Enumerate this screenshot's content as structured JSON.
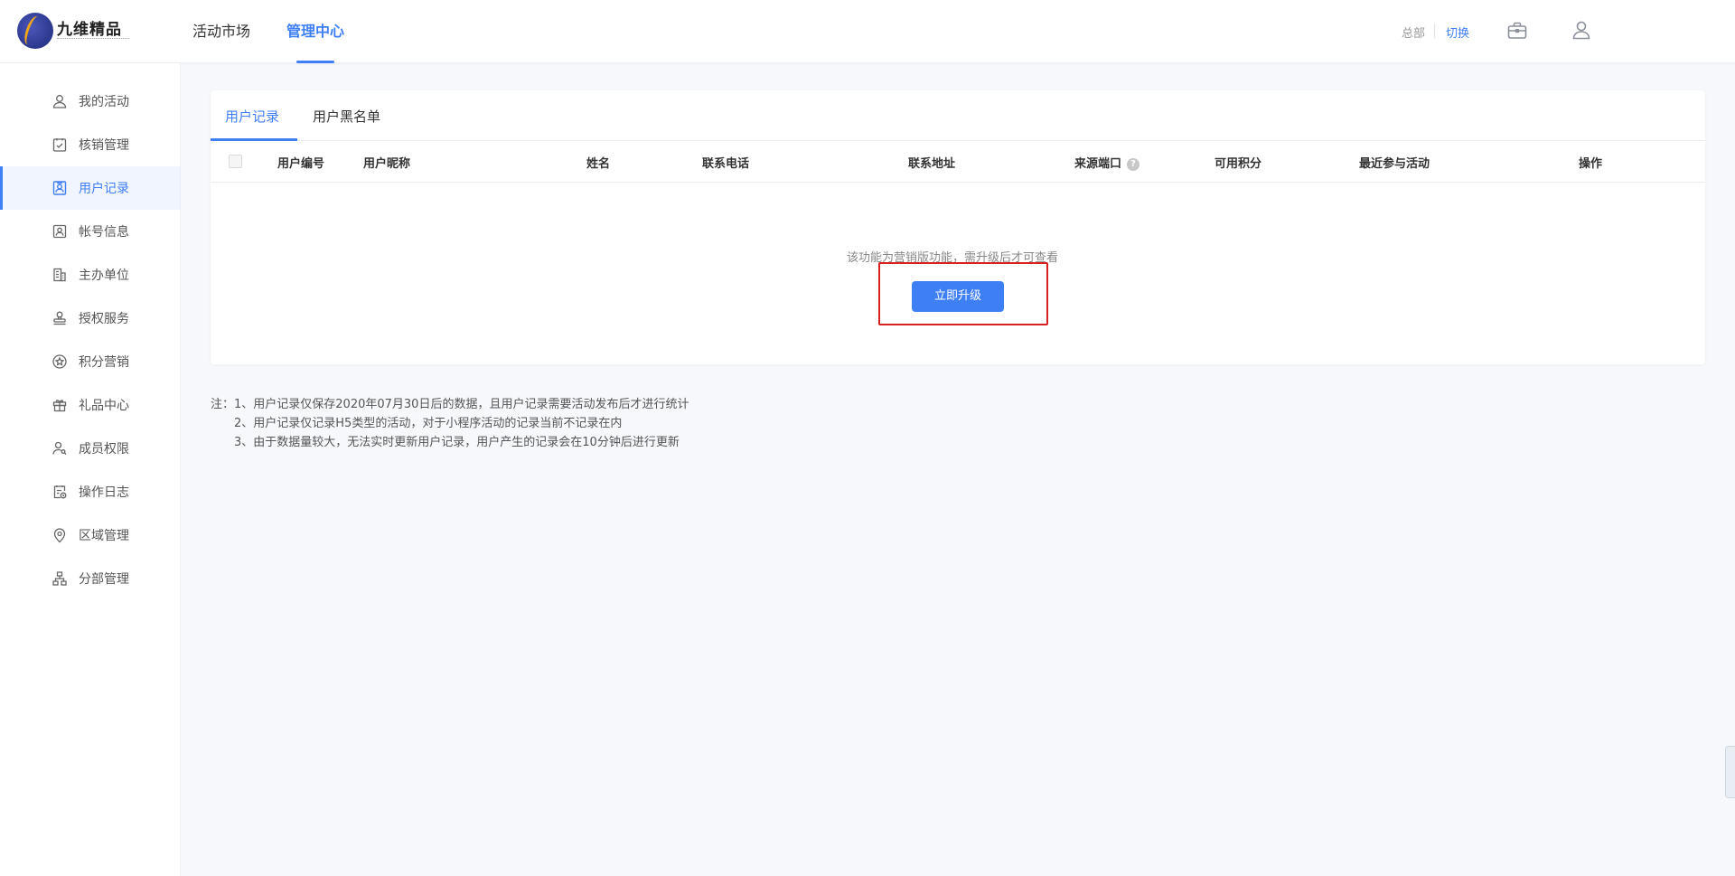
{
  "brand": {
    "name": "九维精品"
  },
  "top_nav": [
    {
      "label": "活动市场",
      "active": false
    },
    {
      "label": "管理中心",
      "active": true
    }
  ],
  "header_right": {
    "org": "总部",
    "switch_label": "切换"
  },
  "sidebar": {
    "items": [
      {
        "label": "我的活动",
        "icon": "user-icon"
      },
      {
        "label": "核销管理",
        "icon": "clipboard-check-icon"
      },
      {
        "label": "用户记录",
        "icon": "user-card-icon",
        "active": true
      },
      {
        "label": "帐号信息",
        "icon": "id-card-icon"
      },
      {
        "label": "主办单位",
        "icon": "building-icon"
      },
      {
        "label": "授权服务",
        "icon": "stamp-icon"
      },
      {
        "label": "积分营销",
        "icon": "star-circle-icon"
      },
      {
        "label": "礼品中心",
        "icon": "gift-icon"
      },
      {
        "label": "成员权限",
        "icon": "user-key-icon"
      },
      {
        "label": "操作日志",
        "icon": "log-icon"
      },
      {
        "label": "区域管理",
        "icon": "location-pin-icon"
      },
      {
        "label": "分部管理",
        "icon": "org-chart-icon"
      }
    ]
  },
  "tabs": [
    {
      "label": "用户记录",
      "active": true
    },
    {
      "label": "用户黑名单",
      "active": false
    }
  ],
  "table": {
    "columns": [
      "用户编号",
      "用户昵称",
      "姓名",
      "联系电话",
      "联系地址",
      "来源端口",
      "可用积分",
      "最近参与活动",
      "操作"
    ]
  },
  "empty_state": {
    "message": "该功能为营销版功能，需升级后才可查看",
    "button": "立即升级"
  },
  "notes": [
    "注：1、用户记录仅保存2020年07月30日后的数据，且用户记录需要活动发布后才进行统计",
    "2、用户记录仅记录H5类型的活动，对于小程序活动的记录当前不记录在内",
    "3、由于数据量较大，无法实时更新用户记录，用户产生的记录会在10分钟后进行更新"
  ],
  "colors": {
    "accent": "#3f7ff6",
    "highlight": "#d92020"
  }
}
